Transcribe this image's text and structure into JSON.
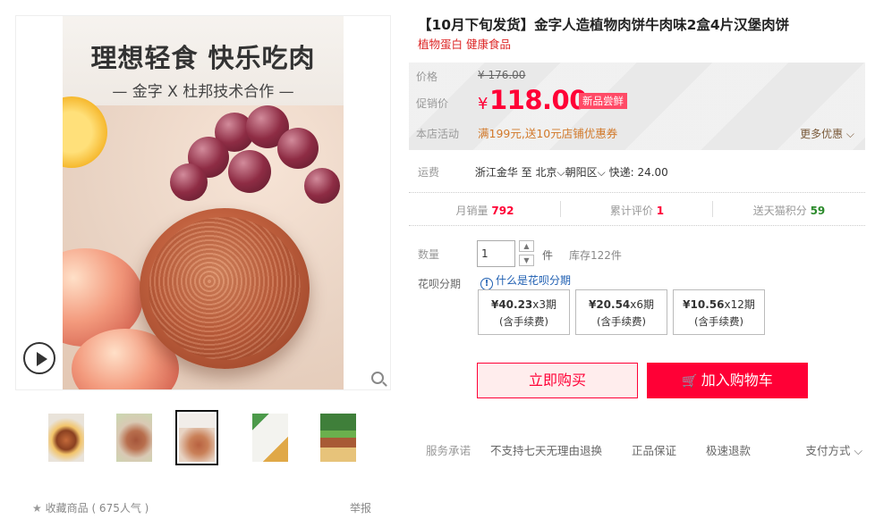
{
  "gallery": {
    "banner_title": "理想轻食 快乐吃肉",
    "banner_sub": "— 金字 X 杜邦技术合作 —",
    "thumbnails": 5,
    "active_thumb": 3
  },
  "product": {
    "title": "【10月下旬发货】金字人造植物肉饼牛肉味2盒4片汉堡肉饼",
    "subtitle": "植物蛋白 健康食品"
  },
  "price": {
    "list_label": "价格",
    "list_price": "¥ 176.00",
    "promo_label": "促销价",
    "yen": "¥",
    "promo_price": "118.00",
    "tag": "新品尝鲜",
    "activity_label": "本店活动",
    "activity_text": "满199元,送10元店铺优惠券",
    "more": "更多优惠"
  },
  "shipping": {
    "label": "运费",
    "from": "浙江金华",
    "to_word": "至",
    "city": "北京",
    "district": "朝阳区",
    "express": "快递: 24.00"
  },
  "stats": {
    "sales_label": "月销量",
    "sales_value": "792",
    "reviews_label": "累计评价",
    "reviews_value": "1",
    "points_label": "送天猫积分",
    "points_value": "59"
  },
  "quantity": {
    "label": "数量",
    "value": "1",
    "unit": "件",
    "stock": "库存122件"
  },
  "huabei": {
    "label": "花呗分期",
    "help": "什么是花呗分期",
    "plans": [
      {
        "amount": "¥40.23",
        "term": "x3期",
        "fee": "(含手续费)"
      },
      {
        "amount": "¥20.54",
        "term": "x6期",
        "fee": "(含手续费)"
      },
      {
        "amount": "¥10.56",
        "term": "x12期",
        "fee": "(含手续费)"
      }
    ]
  },
  "actions": {
    "buy_now": "立即购买",
    "add_cart": "加入购物车"
  },
  "service": {
    "label": "服务承诺",
    "items": [
      "不支持七天无理由退换",
      "正品保证",
      "极速退款"
    ],
    "pay": "支付方式"
  },
  "footer": {
    "collect": "收藏商品",
    "popularity": "( 675人气 )",
    "report": "举报"
  },
  "colors": {
    "accent": "#ff0036",
    "promo_orange": "#d2792a",
    "link_blue": "#1f5fb2"
  }
}
